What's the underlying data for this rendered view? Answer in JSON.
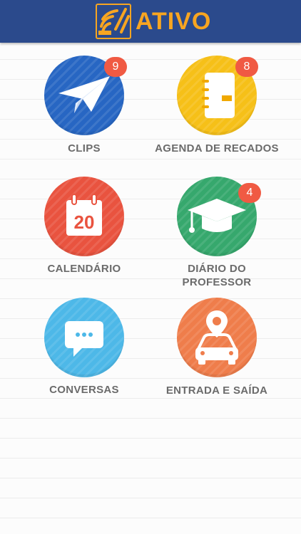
{
  "header": {
    "logo_text": "ATIVO",
    "logo_icon": "sun-rays-icon",
    "background_color": "#2b4a8c",
    "brand_color": "#f7a521"
  },
  "menu": [
    {
      "label": "CLIPS",
      "badge": "9",
      "icon": "paper-plane-icon",
      "color": "#2766c3"
    },
    {
      "label": "AGENDA DE RECADOS",
      "badge": "8",
      "icon": "notebook-icon",
      "color": "#f6c018"
    },
    {
      "label": "CALENDÁRIO",
      "badge": null,
      "icon": "calendar-icon",
      "color": "#e9533f",
      "icon_text": "20"
    },
    {
      "label_line1": "DIÁRIO DO",
      "label_line2": "PROFESSOR",
      "badge": "4",
      "icon": "graduation-cap-icon",
      "color": "#36a86d"
    },
    {
      "label": "CONVERSAS",
      "badge": null,
      "icon": "chat-bubble-icon",
      "color": "#4db8e8"
    },
    {
      "label": "ENTRADA E SAÍDA",
      "badge": null,
      "icon": "car-location-icon",
      "color": "#ef7d4b"
    }
  ]
}
